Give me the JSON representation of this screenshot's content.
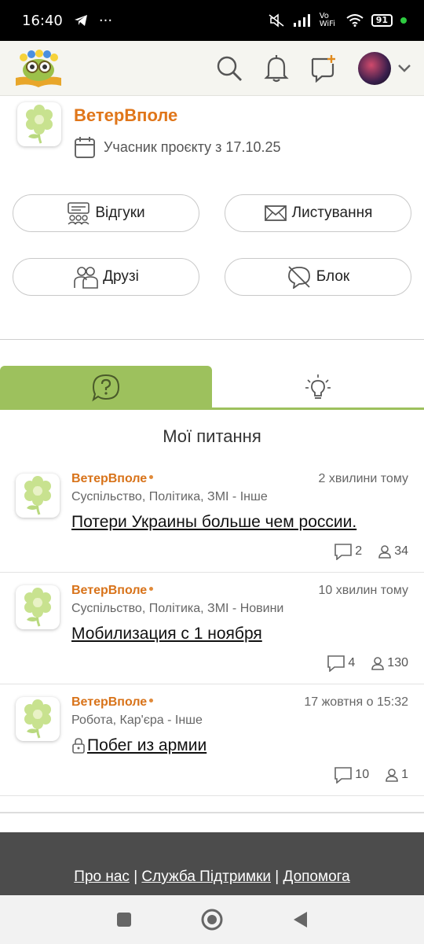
{
  "status_bar": {
    "time": "16:40",
    "dots": "···",
    "network": "Vo WiFi",
    "battery": "91"
  },
  "header": {
    "logo_icon": "owl-logo-icon",
    "actions": [
      "search-icon",
      "bell-icon",
      "new-question-icon"
    ],
    "avatar_menu": "chevron-down-icon"
  },
  "profile": {
    "name": "ВетерВполе",
    "member_since": "Учасник проєкту з 17.10.25"
  },
  "buttons": {
    "reviews": "Відгуки",
    "messages": "Листування",
    "friends": "Друзі",
    "block": "Блок"
  },
  "tabs": {
    "active_icon": "question-icon",
    "inactive_icon": "lightbulb-icon"
  },
  "section_title": "Мої питання",
  "questions": [
    {
      "author": "ВетерВполе",
      "time": "2 хвилини тому",
      "category": "Суспільство, Політика, ЗМІ - Інше",
      "title": "Потери Украины больше чем россии.",
      "comments": "2",
      "views": "34",
      "locked": false
    },
    {
      "author": "ВетерВполе",
      "time": "10 хвилин тому",
      "category": "Суспільство, Політика, ЗМІ - Новини",
      "title": "Мобилизация с 1 ноября",
      "comments": "4",
      "views": "130",
      "locked": false
    },
    {
      "author": "ВетерВполе",
      "time": "17 жовтня о 15:32",
      "category": "Робота, Кар'єра - Інше",
      "title": "Побег из армии",
      "comments": "10",
      "views": "1",
      "locked": true
    }
  ],
  "footer": {
    "about": "Про нас",
    "sep1": "|",
    "support": "Служба Підтримки",
    "sep2": "|",
    "help": "Допомога"
  },
  "colors": {
    "accent_green": "#9dc15d",
    "name_orange": "#e0761a",
    "footer_bg": "#4c4c4c"
  }
}
